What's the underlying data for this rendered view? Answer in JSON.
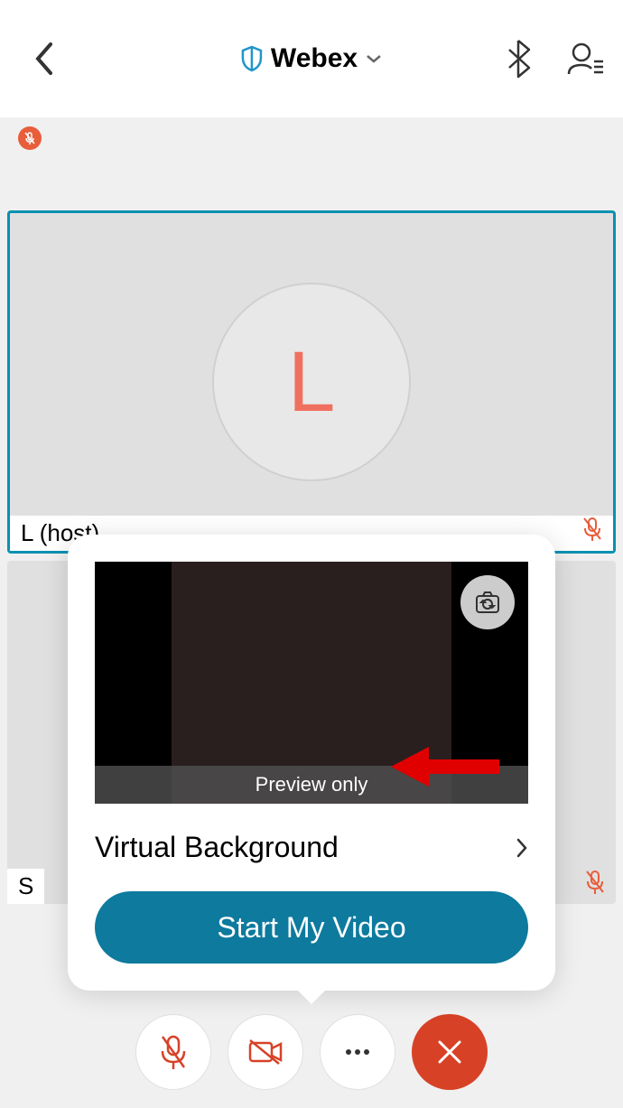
{
  "header": {
    "title": "Webex"
  },
  "tiles": {
    "primary": {
      "avatar_letter": "L",
      "label": "L          (host) "
    },
    "secondary": {
      "label": "S"
    }
  },
  "popup": {
    "preview_label": "Preview only",
    "virtual_background_label": "Virtual Background",
    "start_button_label": "Start My Video"
  }
}
